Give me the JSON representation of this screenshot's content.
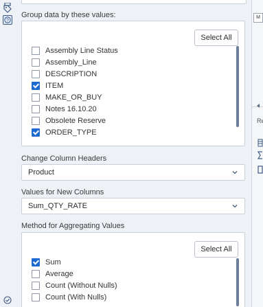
{
  "rail": {
    "icons": [
      "tag-icon",
      "help-icon",
      "check-circle-icon"
    ]
  },
  "group_by": {
    "label": "Group data by these values:",
    "select_all_label": "Select All",
    "items": [
      {
        "label": "Assembly Line Status",
        "checked": false
      },
      {
        "label": "Assembly_Line",
        "checked": false
      },
      {
        "label": "DESCRIPTION",
        "checked": false
      },
      {
        "label": "ITEM",
        "checked": true
      },
      {
        "label": "MAKE_OR_BUY",
        "checked": false
      },
      {
        "label": "Notes 16.10.20",
        "checked": false
      },
      {
        "label": "Obsolete Reserve",
        "checked": false
      },
      {
        "label": "ORDER_TYPE",
        "checked": true
      }
    ]
  },
  "change_headers": {
    "label": "Change Column Headers",
    "value": "Product"
  },
  "values_new_columns": {
    "label": "Values for New Columns",
    "value": "Sum_QTY_RATE"
  },
  "aggregation": {
    "label": "Method for Aggregating Values",
    "select_all_label": "Select All",
    "items": [
      {
        "label": "Sum",
        "checked": true
      },
      {
        "label": "Average",
        "checked": false
      },
      {
        "label": "Count (Without Nulls)",
        "checked": false
      },
      {
        "label": "Count (With Nulls)",
        "checked": false
      }
    ]
  },
  "right_panel": {
    "box_text": "M",
    "tab_text": "Re"
  },
  "colors": {
    "accent": "#1f6ad1",
    "panel_bg": "#eef1f6",
    "scrollbar": "#6b7f99"
  }
}
